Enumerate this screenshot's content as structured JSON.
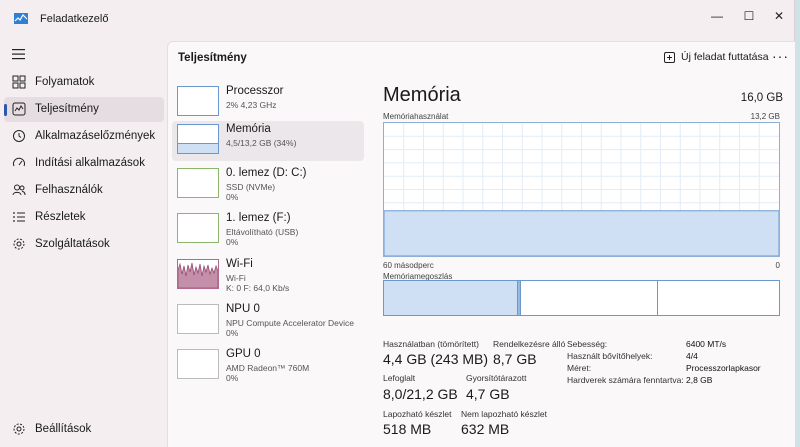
{
  "window": {
    "title": "Feladatkezelő",
    "controls": {
      "minimize": "—",
      "maximize": "☐",
      "close": "✕"
    }
  },
  "sidebar": {
    "items": [
      {
        "label": "Folyamatok",
        "icon": "grid-icon"
      },
      {
        "label": "Teljesítmény",
        "icon": "performance-icon",
        "active": true
      },
      {
        "label": "Alkalmazáselőzmények",
        "icon": "history-icon"
      },
      {
        "label": "Indítási alkalmazások",
        "icon": "speedometer-icon"
      },
      {
        "label": "Felhasználók",
        "icon": "users-icon"
      },
      {
        "label": "Részletek",
        "icon": "list-icon"
      },
      {
        "label": "Szolgáltatások",
        "icon": "gear-icon"
      }
    ],
    "settings_label": "Beállítások"
  },
  "header": {
    "title": "Teljesítmény",
    "run_task_label": "Új feladat futtatása",
    "more_label": "···"
  },
  "perf_list": [
    {
      "name": "Processzor",
      "sub1": "2% 4,23 GHz",
      "sub2": ""
    },
    {
      "name": "Memória",
      "sub1": "4,5/13,2 GB (34%)",
      "sub2": "",
      "active": true,
      "fill": 0.34
    },
    {
      "name": "0. lemez (D: C:)",
      "sub1": "SSD (NVMe)",
      "sub2": "0%"
    },
    {
      "name": "1. lemez (F:)",
      "sub1": "Eltávolítható (USB)",
      "sub2": "0%"
    },
    {
      "name": "Wi-Fi",
      "sub1": "Wi-Fi",
      "sub2": "K: 0 F: 64,0 Kb/s"
    },
    {
      "name": "NPU 0",
      "sub1": "NPU Compute Accelerator Device",
      "sub2": "0%"
    },
    {
      "name": "GPU 0",
      "sub1": "AMD Radeon™ 760M",
      "sub2": "0%"
    }
  ],
  "detail": {
    "title": "Memória",
    "total": "16,0 GB",
    "usage_label": "Memóriahasználat",
    "usage_max": "13,2 GB",
    "time_left": "60 másodperc",
    "time_right": "0",
    "usage_fraction": 0.34,
    "composition_label": "Memóriamegoszlás",
    "stats": {
      "in_use_label": "Használatban (tömörített)",
      "in_use_value": "4,4 GB (243 MB)",
      "available_label": "Rendelkezésre álló",
      "available_value": "8,7 GB",
      "committed_label": "Lefoglalt",
      "committed_value": "8,0/21,2 GB",
      "cached_label": "Gyorsítótárazott",
      "cached_value": "4,7 GB",
      "paged_label": "Lapozható készlet",
      "paged_value": "518 MB",
      "nonpaged_label": "Nem lapozható készlet",
      "nonpaged_value": "632 MB"
    },
    "specs": [
      {
        "label": "Sebesség:",
        "value": "6400 MT/s"
      },
      {
        "label": "Használt bővítőhelyek:",
        "value": "4/4"
      },
      {
        "label": "Méret:",
        "value": "Processzorlapkasor"
      },
      {
        "label": "Hardverek számára fenntartva:",
        "value": "2,8 GB"
      }
    ]
  },
  "colors": {
    "accent": "#2b58a8",
    "memory_fill": "#cfe0f5",
    "memory_line": "#6b99cf"
  }
}
